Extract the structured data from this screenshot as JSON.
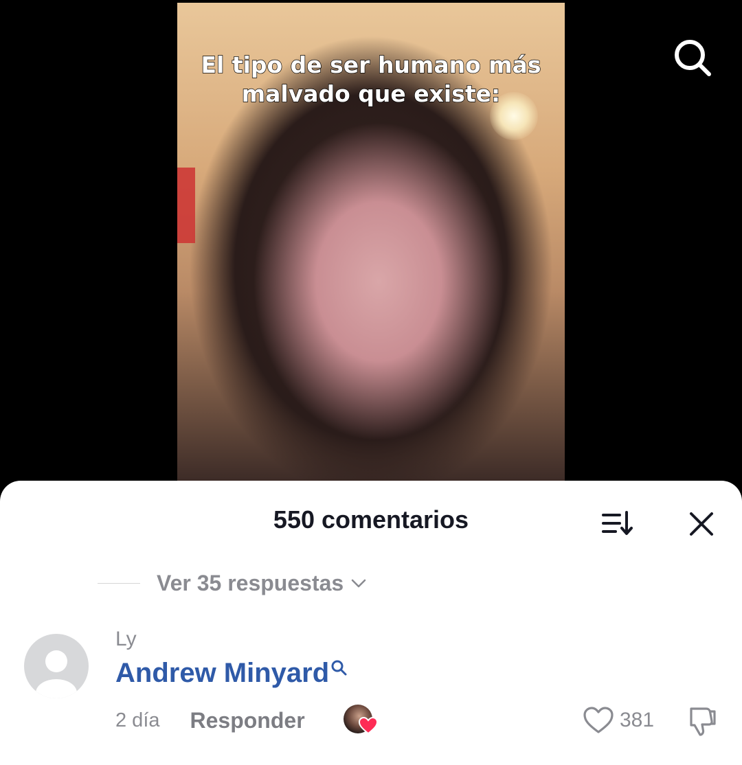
{
  "video": {
    "caption_line1": "El tipo de ser humano más",
    "caption_line2": "malvado que existe:"
  },
  "comments_sheet": {
    "title": "550 comentarios",
    "view_replies_label": "Ver 35 respuestas",
    "comment": {
      "username": "Ly",
      "text": "Andrew Minyard",
      "time": "2 día",
      "reply_label": "Responder",
      "like_count": "381"
    }
  },
  "colors": {
    "link_blue": "#2f5aa8",
    "muted_gray": "#8a8b91",
    "heart_red": "#fe2c55"
  },
  "icons": [
    "search-icon",
    "sort-icon",
    "close-icon",
    "chevron-down-icon",
    "magnifier-mention-icon",
    "heart-outline-icon",
    "thumbs-down-icon",
    "creator-heart-icon"
  ]
}
